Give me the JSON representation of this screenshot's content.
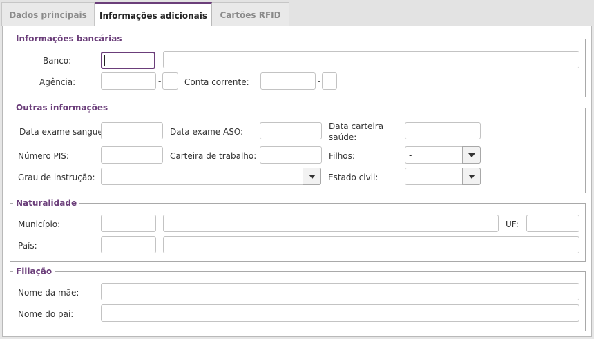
{
  "tabs": [
    {
      "label": "Dados principais"
    },
    {
      "label": "Informações adicionais"
    },
    {
      "label": "Cartões RFID"
    }
  ],
  "bancarias": {
    "legend": "Informações bancárias",
    "banco_label": "Banco:",
    "agencia_label": "Agência:",
    "conta_label": "Conta corrente:",
    "separator": "-"
  },
  "outras": {
    "legend": "Outras informações",
    "exame_sangue_label": "Data exame sangue:",
    "exame_aso_label": "Data exame ASO:",
    "carteira_saude_label_1": "Data carteira",
    "carteira_saude_label_2": "saúde:",
    "pis_label": "Número PIS:",
    "carteira_trabalho_label": "Carteira de trabalho:",
    "filhos_label": "Filhos:",
    "filhos_value": "-",
    "grau_label": "Grau de instrução:",
    "grau_value": "-",
    "estado_civil_label": "Estado civil:",
    "estado_civil_value": "-"
  },
  "naturalidade": {
    "legend": "Naturalidade",
    "municipio_label": "Município:",
    "uf_label": "UF:",
    "pais_label": "País:"
  },
  "filiacao": {
    "legend": "Filiação",
    "mae_label": "Nome da mãe:",
    "pai_label": "Nome do pai:"
  },
  "accent_color": "#6b3e7a",
  "icons": {
    "dropdown": "chevron-down-icon"
  }
}
